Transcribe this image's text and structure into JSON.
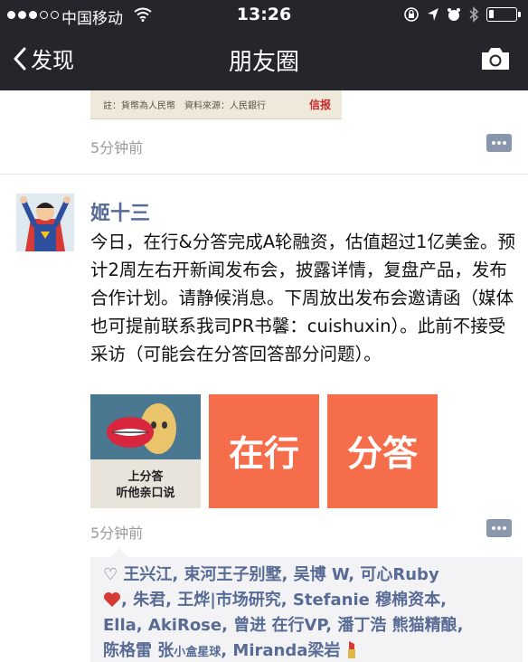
{
  "status_bar": {
    "carrier": "中国移动",
    "time": "13:26",
    "battery_level": 0.2
  },
  "nav": {
    "back_label": "发现",
    "title": "朋友圈"
  },
  "previous_post": {
    "image_caption": "註：貨幣為人民幣　資料來源：人民銀行",
    "image_mark": "信报",
    "timestamp": "5分钟前"
  },
  "post": {
    "author": "姬十三",
    "text": "今日，在行&分答完成A轮融资，估值超过1亿美金。预计2周左右开新闻发布会，披露详情，复盘产品，发布合作计划。请静候消息。下周放出发布会邀请函（媒体也可提前联系我司PR书馨：cuishuxin）。此前不接受采访（可能会在分答回答部分问题）。",
    "images": [
      {
        "caption_line1": "上分答",
        "caption_line2": "听他亲口说"
      },
      {
        "text": "在行"
      },
      {
        "text": "分答"
      }
    ],
    "timestamp": "5分钟前"
  },
  "likes": {
    "line1": "王兴江, 束河王子别墅, 吴博 W, 可心Ruby",
    "line2": ", 朱君, 王烨|市场研究, Stefanie 穆棉资本,",
    "line3": "Ella, AkiRose, 曾进 在行VP, 潘丁浩 熊猫精酿,",
    "line4a": "陈格雷",
    "line4b": "张",
    "line4small": "小盒星球",
    "line4c": ", Miranda梁岩"
  },
  "colors": {
    "nav_bg": "#25262b",
    "link_blue": "#576b95",
    "orange_tile": "#f56d4a",
    "comment_btn": "#8a96ac"
  },
  "icons": [
    "back-chevron-icon",
    "camera-icon",
    "wifi-icon",
    "lock-rotation-icon",
    "location-icon",
    "alarm-icon",
    "bluetooth-icon",
    "battery-icon",
    "comment-icon",
    "heart-outline-icon",
    "heart-emoji-icon",
    "lipstick-emoji-icon"
  ]
}
